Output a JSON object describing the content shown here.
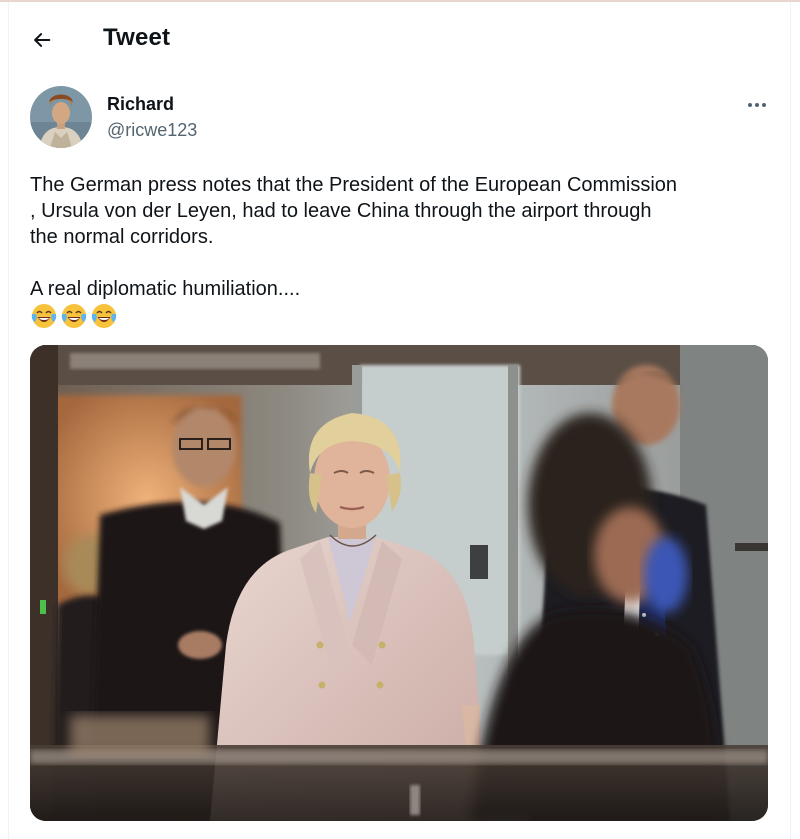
{
  "header": {
    "title": "Tweet",
    "back_icon": "arrow-left-icon"
  },
  "author": {
    "display_name": "Richard",
    "handle": "@ricwe123",
    "avatar_icon": "avatar-portrait"
  },
  "more_icon": "more-horizontal-icon",
  "tweet": {
    "lines": [
      "The German press notes that the President of the European Commission",
      ", Ursula von der Leyen, had to leave China through the airport through",
      "the normal corridors."
    ],
    "second_paragraph": "A real diplomatic humiliation....",
    "emojis": [
      "face-with-tears-of-joy-icon",
      "face-with-tears-of-joy-icon",
      "face-with-tears-of-joy-icon"
    ]
  },
  "media": {
    "type": "photo"
  },
  "colors": {
    "text": "#0f1419",
    "secondary": "#536471",
    "border": "#eff3f4"
  }
}
